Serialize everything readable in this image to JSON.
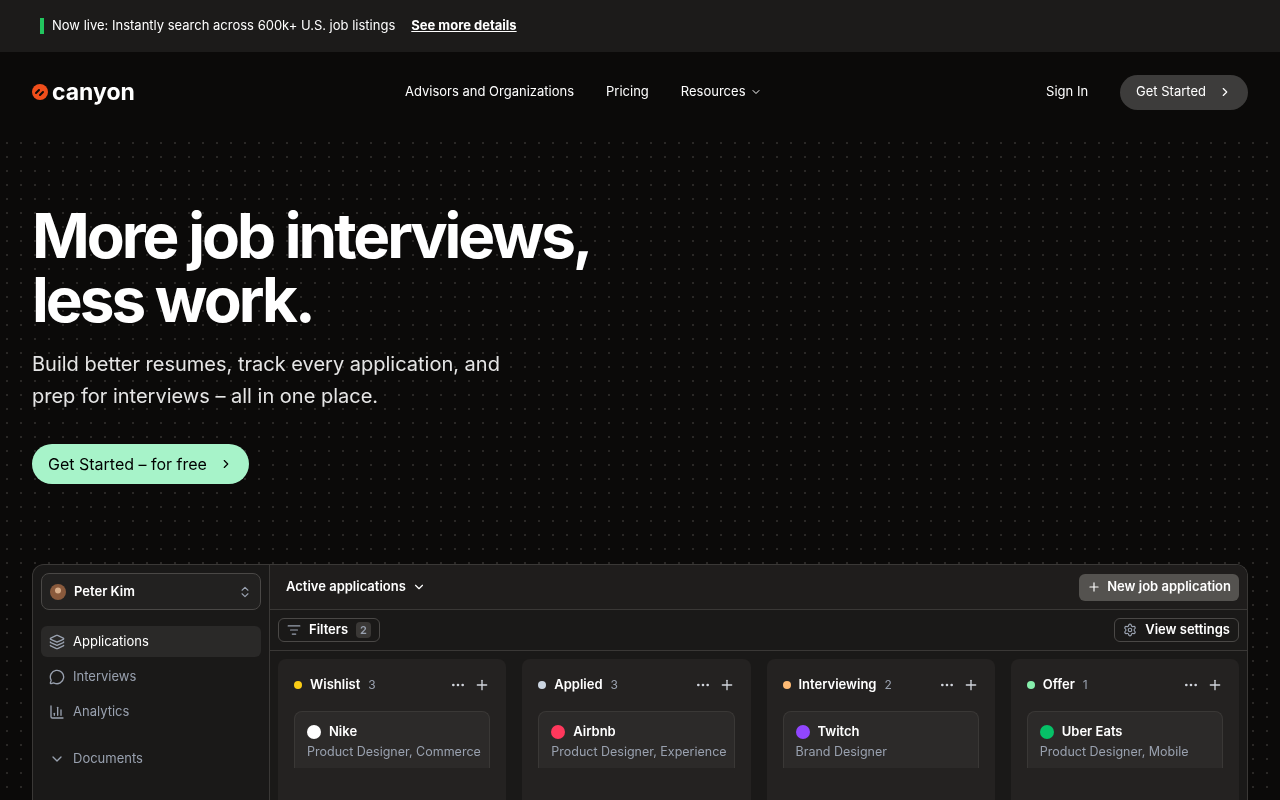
{
  "banner": {
    "text": "Now live: Instantly search across 600k+ U.S. job listings",
    "link": "See more details"
  },
  "nav": {
    "logo": "canyon",
    "links": [
      {
        "label": "Advisors and Organizations",
        "dropdown": false
      },
      {
        "label": "Pricing",
        "dropdown": false
      },
      {
        "label": "Resources",
        "dropdown": true
      }
    ],
    "sign_in": "Sign In",
    "cta": "Get Started"
  },
  "hero": {
    "title_lines": [
      "More job interviews,",
      "less work."
    ],
    "subtitle": "Build better resumes, track every application, and prep for interviews – all in one place.",
    "cta": "Get Started – for free"
  },
  "app": {
    "user": "Peter Kim",
    "sidebar": [
      {
        "label": "Applications",
        "kind": "layers",
        "selected": true
      },
      {
        "label": "Interviews",
        "kind": "chat",
        "selected": false
      },
      {
        "label": "Analytics",
        "kind": "chart",
        "selected": false
      },
      {
        "label": "Documents",
        "kind": "group",
        "selected": false
      }
    ],
    "view": "Active applications",
    "new_button": "New job application",
    "filters": {
      "label": "Filters",
      "count": "2"
    },
    "view_settings": "View settings",
    "columns": [
      {
        "name": "Wishlist",
        "count": "3",
        "color": "#facc15",
        "cards": [
          {
            "company": "Nike",
            "role": "Product Designer, Commerce",
            "color": "#ffffff"
          }
        ]
      },
      {
        "name": "Applied",
        "count": "3",
        "color": "#cbd5e1",
        "cards": [
          {
            "company": "Airbnb",
            "role": "Product Designer, Experience",
            "color": "#ff385c"
          }
        ]
      },
      {
        "name": "Interviewing",
        "count": "2",
        "color": "#fdba74",
        "cards": [
          {
            "company": "Twitch",
            "role": "Brand Designer",
            "color": "#9146ff"
          }
        ]
      },
      {
        "name": "Offer",
        "count": "1",
        "color": "#86efac",
        "cards": [
          {
            "company": "Uber Eats",
            "role": "Product Designer, Mobile",
            "color": "#06c167"
          }
        ]
      }
    ]
  }
}
